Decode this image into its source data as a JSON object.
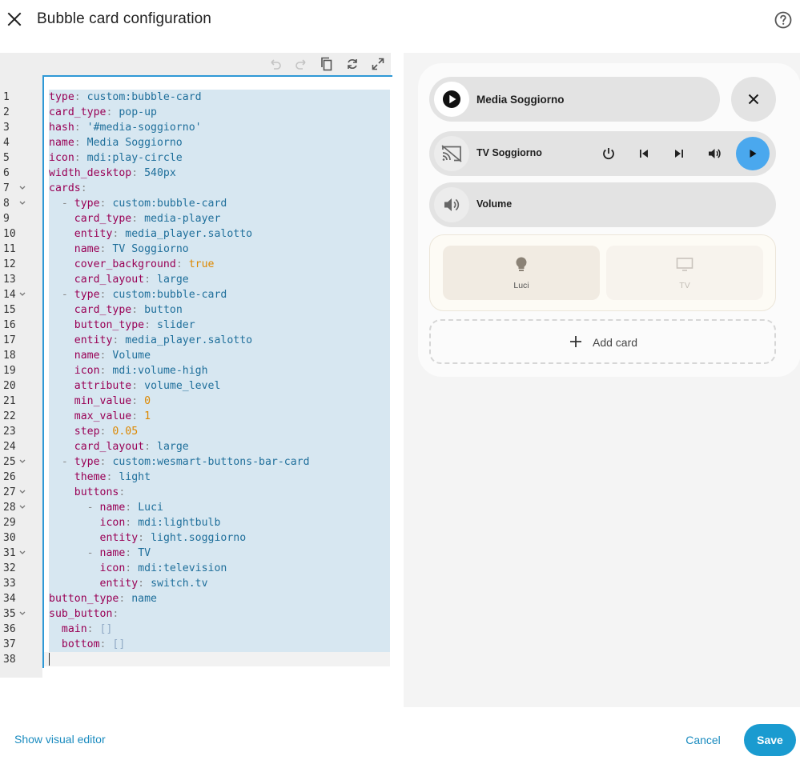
{
  "dialog": {
    "title": "Bubble card configuration"
  },
  "editor": {
    "toolbar": [
      "undo-icon",
      "redo-icon",
      "copy-icon",
      "refresh-icon",
      "fullscreen-icon"
    ],
    "lines": [
      {
        "n": "1",
        "fold": false,
        "text": "type: custom:bubble-card"
      },
      {
        "n": "2",
        "fold": false,
        "text": "card_type: pop-up"
      },
      {
        "n": "3",
        "fold": false,
        "text": "hash: '#media-soggiorno'"
      },
      {
        "n": "4",
        "fold": false,
        "text": "name: Media Soggiorno"
      },
      {
        "n": "5",
        "fold": false,
        "text": "icon: mdi:play-circle"
      },
      {
        "n": "6",
        "fold": false,
        "text": "width_desktop: 540px"
      },
      {
        "n": "7",
        "fold": true,
        "text": "cards:"
      },
      {
        "n": "8",
        "fold": true,
        "text": "  - type: custom:bubble-card"
      },
      {
        "n": "9",
        "fold": false,
        "text": "    card_type: media-player"
      },
      {
        "n": "10",
        "fold": false,
        "text": "    entity: media_player.salotto"
      },
      {
        "n": "11",
        "fold": false,
        "text": "    name: TV Soggiorno"
      },
      {
        "n": "12",
        "fold": false,
        "text": "    cover_background: true"
      },
      {
        "n": "13",
        "fold": false,
        "text": "    card_layout: large"
      },
      {
        "n": "14",
        "fold": true,
        "text": "  - type: custom:bubble-card"
      },
      {
        "n": "15",
        "fold": false,
        "text": "    card_type: button"
      },
      {
        "n": "16",
        "fold": false,
        "text": "    button_type: slider"
      },
      {
        "n": "17",
        "fold": false,
        "text": "    entity: media_player.salotto"
      },
      {
        "n": "18",
        "fold": false,
        "text": "    name: Volume"
      },
      {
        "n": "19",
        "fold": false,
        "text": "    icon: mdi:volume-high"
      },
      {
        "n": "20",
        "fold": false,
        "text": "    attribute: volume_level"
      },
      {
        "n": "21",
        "fold": false,
        "text": "    min_value: 0"
      },
      {
        "n": "22",
        "fold": false,
        "text": "    max_value: 1"
      },
      {
        "n": "23",
        "fold": false,
        "text": "    step: 0.05"
      },
      {
        "n": "24",
        "fold": false,
        "text": "    card_layout: large"
      },
      {
        "n": "25",
        "fold": true,
        "text": "  - type: custom:wesmart-buttons-bar-card"
      },
      {
        "n": "26",
        "fold": false,
        "text": "    theme: light"
      },
      {
        "n": "27",
        "fold": true,
        "text": "    buttons:"
      },
      {
        "n": "28",
        "fold": true,
        "text": "      - name: Luci"
      },
      {
        "n": "29",
        "fold": false,
        "text": "        icon: mdi:lightbulb"
      },
      {
        "n": "30",
        "fold": false,
        "text": "        entity: light.soggiorno"
      },
      {
        "n": "31",
        "fold": true,
        "text": "      - name: TV"
      },
      {
        "n": "32",
        "fold": false,
        "text": "        icon: mdi:television"
      },
      {
        "n": "33",
        "fold": false,
        "text": "        entity: switch.tv"
      },
      {
        "n": "34",
        "fold": false,
        "text": "button_type: name"
      },
      {
        "n": "35",
        "fold": true,
        "text": "sub_button:"
      },
      {
        "n": "36",
        "fold": false,
        "text": "  main: []"
      },
      {
        "n": "37",
        "fold": false,
        "text": "  bottom: []"
      },
      {
        "n": "38",
        "fold": false,
        "text": ""
      }
    ]
  },
  "preview": {
    "header_card": {
      "name": "Media Soggiorno",
      "icon": "play-circle-icon"
    },
    "close_icon": "close-icon",
    "media_player": {
      "name": "TV Soggiorno",
      "icon": "cast-icon",
      "controls": [
        "power-icon",
        "previous-icon",
        "next-icon",
        "volume-icon",
        "play-icon"
      ]
    },
    "volume_slider": {
      "name": "Volume",
      "icon": "volume-high-icon"
    },
    "buttons_bar": [
      {
        "name": "Luci",
        "icon": "lightbulb-icon",
        "active": true
      },
      {
        "name": "TV",
        "icon": "television-icon",
        "active": false
      }
    ],
    "add_card_label": "Add card"
  },
  "footer": {
    "show_visual_editor": "Show visual editor",
    "cancel": "Cancel",
    "save": "Save"
  },
  "colors": {
    "accent": "#1a9bd0",
    "play_button": "#4aa8ee",
    "selection": "#d7e7f1"
  }
}
